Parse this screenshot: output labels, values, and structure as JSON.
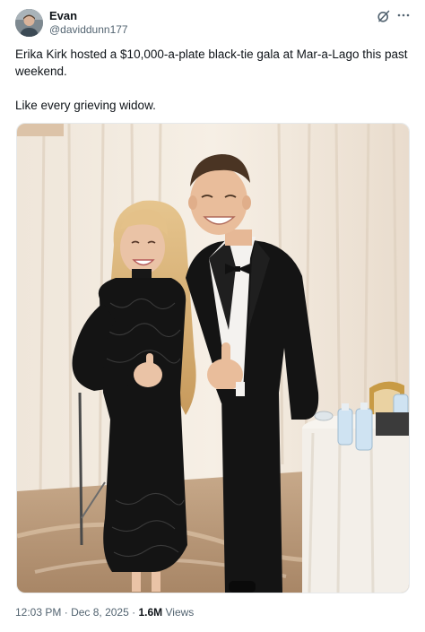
{
  "post": {
    "author": {
      "display_name": "Evan",
      "handle": "@daviddunn177",
      "avatar_icon": "avatar-photo"
    },
    "actions": {
      "grok_icon": "grok-icon",
      "more_icon": "more-horizontal-icon"
    },
    "text": {
      "line1": "Erika Kirk hosted a $10,000-a-plate black-tie gala at Mar-a-Lago this past weekend.",
      "line2": "Like every grieving widow."
    },
    "media": {
      "kind": "photo"
    },
    "meta": {
      "time": "12:03 PM",
      "date": "Dec 8, 2025",
      "separator": "·",
      "views_count": "1.6M",
      "views_label": "Views"
    }
  },
  "colors": {
    "text_primary": "#0f1419",
    "text_secondary": "#536471",
    "background": "#ffffff"
  }
}
